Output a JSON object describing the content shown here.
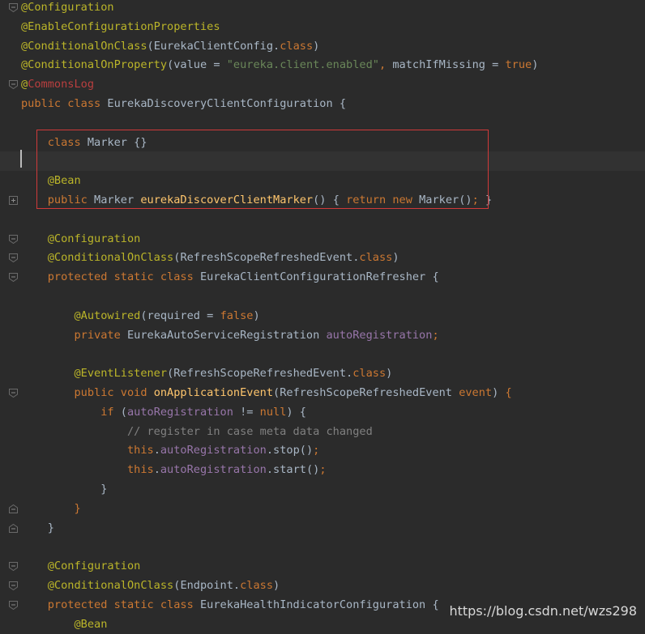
{
  "editor": {
    "lines": [
      [
        {
          "t": "@Configuration",
          "c": "ann"
        }
      ],
      [
        {
          "t": "@EnableConfigurationProperties",
          "c": "ann"
        }
      ],
      [
        {
          "t": "@ConditionalOnClass",
          "c": "ann"
        },
        {
          "t": "(",
          "c": "cls"
        },
        {
          "t": "EurekaClientConfig",
          "c": "cls"
        },
        {
          "t": ".",
          "c": "cls"
        },
        {
          "t": "class",
          "c": "kw"
        },
        {
          "t": ")",
          "c": "cls"
        }
      ],
      [
        {
          "t": "@ConditionalOnProperty",
          "c": "ann"
        },
        {
          "t": "(",
          "c": "cls"
        },
        {
          "t": "value",
          "c": "cls"
        },
        {
          "t": " = ",
          "c": "cls"
        },
        {
          "t": "\"eureka.client.enabled\"",
          "c": "str"
        },
        {
          "t": ", ",
          "c": "pun"
        },
        {
          "t": "matchIfMissing",
          "c": "cls"
        },
        {
          "t": " = ",
          "c": "cls"
        },
        {
          "t": "true",
          "c": "kw"
        },
        {
          "t": ")",
          "c": "cls"
        }
      ],
      [
        {
          "t": "@",
          "c": "ann"
        },
        {
          "t": "CommonsLog",
          "c": "commons-name"
        }
      ],
      [
        {
          "t": "public class ",
          "c": "kw"
        },
        {
          "t": "EurekaDiscoveryClientConfiguration ",
          "c": "cls"
        },
        {
          "t": "{",
          "c": "cls"
        }
      ],
      [],
      [
        {
          "t": "    class ",
          "c": "kw"
        },
        {
          "t": "Marker ",
          "c": "cls"
        },
        {
          "t": "{}",
          "c": "cls"
        }
      ],
      [],
      [
        {
          "t": "    @Bean",
          "c": "ann"
        }
      ],
      [
        {
          "t": "    public ",
          "c": "kw"
        },
        {
          "t": "Marker ",
          "c": "cls"
        },
        {
          "t": "eurekaDiscoverClientMarker",
          "c": "fn"
        },
        {
          "t": "() ",
          "c": "cls"
        },
        {
          "t": "{ ",
          "c": "cls"
        },
        {
          "t": "return new ",
          "c": "kw"
        },
        {
          "t": "Marker",
          "c": "cls"
        },
        {
          "t": "()",
          "c": "cls"
        },
        {
          "t": "; ",
          "c": "pun"
        },
        {
          "t": "}",
          "c": "cls"
        }
      ],
      [],
      [
        {
          "t": "    @Configuration",
          "c": "ann"
        }
      ],
      [
        {
          "t": "    @ConditionalOnClass",
          "c": "ann"
        },
        {
          "t": "(",
          "c": "cls"
        },
        {
          "t": "RefreshScopeRefreshedEvent",
          "c": "cls"
        },
        {
          "t": ".",
          "c": "cls"
        },
        {
          "t": "class",
          "c": "kw"
        },
        {
          "t": ")",
          "c": "cls"
        }
      ],
      [
        {
          "t": "    protected static class ",
          "c": "kw"
        },
        {
          "t": "EurekaClientConfigurationRefresher ",
          "c": "cls"
        },
        {
          "t": "{",
          "c": "cls"
        }
      ],
      [],
      [
        {
          "t": "        @Autowired",
          "c": "ann"
        },
        {
          "t": "(",
          "c": "cls"
        },
        {
          "t": "required",
          "c": "cls"
        },
        {
          "t": " = ",
          "c": "cls"
        },
        {
          "t": "false",
          "c": "kw"
        },
        {
          "t": ")",
          "c": "cls"
        }
      ],
      [
        {
          "t": "        private ",
          "c": "kw"
        },
        {
          "t": "EurekaAutoServiceRegistration ",
          "c": "cls"
        },
        {
          "t": "autoRegistration",
          "c": "fld"
        },
        {
          "t": ";",
          "c": "pun"
        }
      ],
      [],
      [
        {
          "t": "        @EventListener",
          "c": "ann"
        },
        {
          "t": "(",
          "c": "cls"
        },
        {
          "t": "RefreshScopeRefreshedEvent",
          "c": "cls"
        },
        {
          "t": ".",
          "c": "cls"
        },
        {
          "t": "class",
          "c": "kw"
        },
        {
          "t": ")",
          "c": "cls"
        }
      ],
      [
        {
          "t": "        public void ",
          "c": "kw"
        },
        {
          "t": "onApplicationEvent",
          "c": "fn"
        },
        {
          "t": "(",
          "c": "cls"
        },
        {
          "t": "RefreshScopeRefreshedEvent ",
          "c": "cls"
        },
        {
          "t": "event",
          "c": "kw"
        },
        {
          "t": ") ",
          "c": "cls"
        },
        {
          "t": "{",
          "c": "kw"
        }
      ],
      [
        {
          "t": "            if ",
          "c": "kw"
        },
        {
          "t": "(",
          "c": "cls"
        },
        {
          "t": "autoRegistration",
          "c": "fld"
        },
        {
          "t": " != ",
          "c": "cls"
        },
        {
          "t": "null",
          "c": "kw"
        },
        {
          "t": ") ",
          "c": "cls"
        },
        {
          "t": "{",
          "c": "cls"
        }
      ],
      [
        {
          "t": "                // register in case meta data changed",
          "c": "cmt"
        }
      ],
      [
        {
          "t": "                this",
          "c": "kw"
        },
        {
          "t": ".",
          "c": "cls"
        },
        {
          "t": "autoRegistration",
          "c": "fld"
        },
        {
          "t": ".",
          "c": "cls"
        },
        {
          "t": "stop",
          "c": "cls"
        },
        {
          "t": "()",
          "c": "cls"
        },
        {
          "t": ";",
          "c": "pun"
        }
      ],
      [
        {
          "t": "                this",
          "c": "kw"
        },
        {
          "t": ".",
          "c": "cls"
        },
        {
          "t": "autoRegistration",
          "c": "fld"
        },
        {
          "t": ".",
          "c": "cls"
        },
        {
          "t": "start",
          "c": "cls"
        },
        {
          "t": "()",
          "c": "cls"
        },
        {
          "t": ";",
          "c": "pun"
        }
      ],
      [
        {
          "t": "            }",
          "c": "cls"
        }
      ],
      [
        {
          "t": "        }",
          "c": "kw"
        }
      ],
      [
        {
          "t": "    }",
          "c": "cls"
        }
      ],
      [],
      [
        {
          "t": "    @Configuration",
          "c": "ann"
        }
      ],
      [
        {
          "t": "    @ConditionalOnClass",
          "c": "ann"
        },
        {
          "t": "(",
          "c": "cls"
        },
        {
          "t": "Endpoint",
          "c": "cls"
        },
        {
          "t": ".",
          "c": "cls"
        },
        {
          "t": "class",
          "c": "kw"
        },
        {
          "t": ")",
          "c": "cls"
        }
      ],
      [
        {
          "t": "    protected static class ",
          "c": "kw"
        },
        {
          "t": "EurekaHealthIndicatorConfiguration ",
          "c": "cls"
        },
        {
          "t": "{",
          "c": "cls"
        }
      ],
      [
        {
          "t": "        @Bean",
          "c": "ann"
        }
      ]
    ],
    "current_line_index": 8,
    "highlighted_lines": [
      7,
      8,
      9,
      10
    ]
  },
  "watermark": "https://blog.csdn.net/wzs298"
}
